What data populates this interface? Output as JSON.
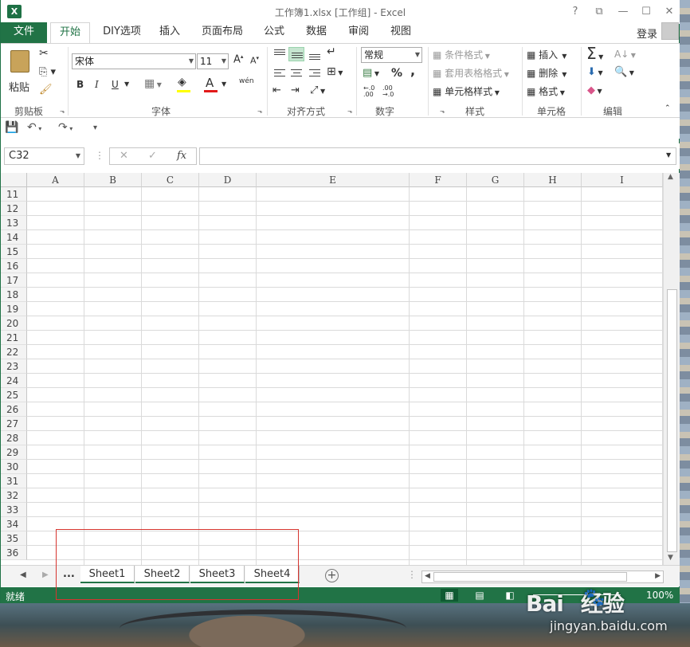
{
  "window": {
    "title": "工作簿1.xlsx  [工作组] - Excel",
    "app_icon": "X",
    "controls": [
      "?",
      "⧉",
      "—",
      "☐",
      "✕"
    ]
  },
  "ribbon_tabs": [
    "文件",
    "开始",
    "DIY选项",
    "插入",
    "页面布局",
    "公式",
    "数据",
    "审阅",
    "视图"
  ],
  "active_tab": "开始",
  "account": {
    "login_label": "登录"
  },
  "clipboard": {
    "paste_label": "粘贴",
    "group_label": "剪贴板"
  },
  "font": {
    "name": "宋体",
    "size": "11",
    "bold": "B",
    "italic": "I",
    "underline": "U",
    "wen": "wén",
    "group_label": "字体",
    "fill_color": "#ffff00",
    "font_color": "#e21a1a"
  },
  "alignment": {
    "group_label": "对齐方式"
  },
  "number": {
    "format": "常规",
    "percent": "%",
    "comma": ",",
    "group_label": "数字"
  },
  "styles": {
    "conditional": "条件格式",
    "table_format": "套用表格格式",
    "cell_styles": "单元格样式",
    "group_label": "样式"
  },
  "cells": {
    "insert": "插入",
    "delete": "删除",
    "format": "格式",
    "group_label": "单元格"
  },
  "editing": {
    "group_label": "编辑"
  },
  "formula_bar": {
    "name_box": "C32",
    "cancel": "✕",
    "enter": "✓",
    "fx": "fx",
    "value": ""
  },
  "columns": [
    "A",
    "B",
    "C",
    "D",
    "E",
    "F",
    "G",
    "H",
    "I"
  ],
  "rows": [
    "11",
    "12",
    "13",
    "14",
    "15",
    "16",
    "17",
    "18",
    "19",
    "20",
    "21",
    "22",
    "23",
    "24",
    "25",
    "26",
    "27",
    "28",
    "29",
    "30",
    "31",
    "32",
    "33",
    "34",
    "35",
    "36"
  ],
  "sheets": {
    "ellipsis": "...",
    "tabs": [
      "Sheet1",
      "Sheet2",
      "Sheet3",
      "Sheet4"
    ],
    "add": "+"
  },
  "status": {
    "text": "就绪",
    "zoom": "100%"
  },
  "watermark": {
    "logo": "Bai",
    "logo2": "经验",
    "url": "jingyan.baidu.com"
  },
  "colors": {
    "excel_green": "#217346",
    "annotation_red": "#d6352f"
  }
}
